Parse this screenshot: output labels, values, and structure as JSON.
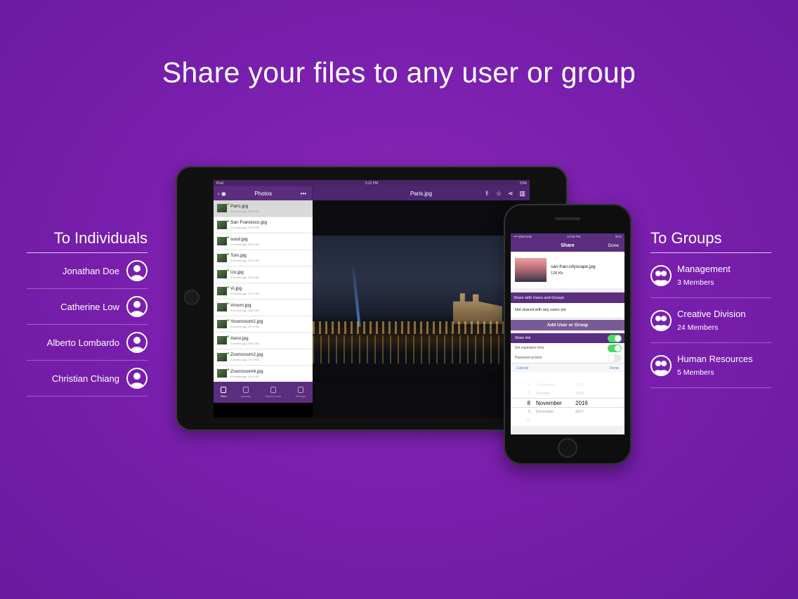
{
  "headline": "Share your files to any user or group",
  "individuals": {
    "title": "To Individuals",
    "people": [
      "Jonathan Doe",
      "Catherine Low",
      "Alberto Lombardo",
      "Christian Chiang"
    ]
  },
  "groups": {
    "title": "To Groups",
    "items": [
      {
        "name": "Management",
        "members": "3 Members"
      },
      {
        "name": "Creative Division",
        "members": "24 Members"
      },
      {
        "name": "Human Resources",
        "members": "5 Members"
      }
    ]
  },
  "ipad": {
    "status": {
      "carrier": "iPad",
      "time": "3:12 PM",
      "battery": "53%"
    },
    "folder_title": "Photos",
    "file_title": "Paris.jpg",
    "files": [
      {
        "name": "Paris.jpg",
        "meta": "3 months ago, 155.4 KB"
      },
      {
        "name": "San Francisco.jpg",
        "meta": "3 months ago, 217.0 KB"
      },
      {
        "name": "sood.jpg",
        "meta": "3 months ago, 228.3 KB"
      },
      {
        "name": "Tom.jpg",
        "meta": "3 months ago, 217.0 KB"
      },
      {
        "name": "Uo.jpg",
        "meta": "3 months ago, 228.3 KB"
      },
      {
        "name": "Vi.jpg",
        "meta": "3 months ago, 217.0 KB"
      },
      {
        "name": "Vroom.jpg",
        "meta": "3 months ago, 228.3 KB"
      },
      {
        "name": "Yoomzoom2.jpg",
        "meta": "3 months ago, 217.0 KB"
      },
      {
        "name": "Xeno.jpg",
        "meta": "3 months ago, 228.3 KB"
      },
      {
        "name": "Zoomzoom2.jpg",
        "meta": "3 months ago, 217.0 KB"
      },
      {
        "name": "Zoomzoom4.jpg",
        "meta": "3 months ago, 228.3 KB"
      }
    ],
    "tabs": [
      "Files",
      "Uploads",
      "Shared Links",
      "Settings"
    ]
  },
  "iphone": {
    "status": {
      "carrier": "•••• Bitemedy",
      "time": "12:56 PM",
      "battery": "91%"
    },
    "nav_title": "Share",
    "done_label": "Done",
    "file_name": "san-fran-cityscape.jpg",
    "file_size": "128 Kb",
    "section_title": "Share with Users and Groups",
    "not_shared": "Not shared with any users yet",
    "add_button": "Add User or Group",
    "share_link_label": "Share link",
    "expiration_label": "Set expiration time",
    "password_label": "Password protect",
    "cancel_label": "Cancel",
    "picker_done": "Done",
    "picker_rows": [
      {
        "d": "",
        "m": "",
        "y": ""
      },
      {
        "d": "6",
        "m": "September",
        "y": "2014"
      },
      {
        "d": "7",
        "m": "October",
        "y": "2015"
      },
      {
        "d": "8",
        "m": "November",
        "y": "2016"
      },
      {
        "d": "9",
        "m": "December",
        "y": "2017"
      },
      {
        "d": "10",
        "m": "",
        "y": ""
      }
    ]
  },
  "colors": {
    "background": "#7a1fae",
    "app_purple": "#5a2d7e",
    "toggle_on": "#4cd964"
  }
}
